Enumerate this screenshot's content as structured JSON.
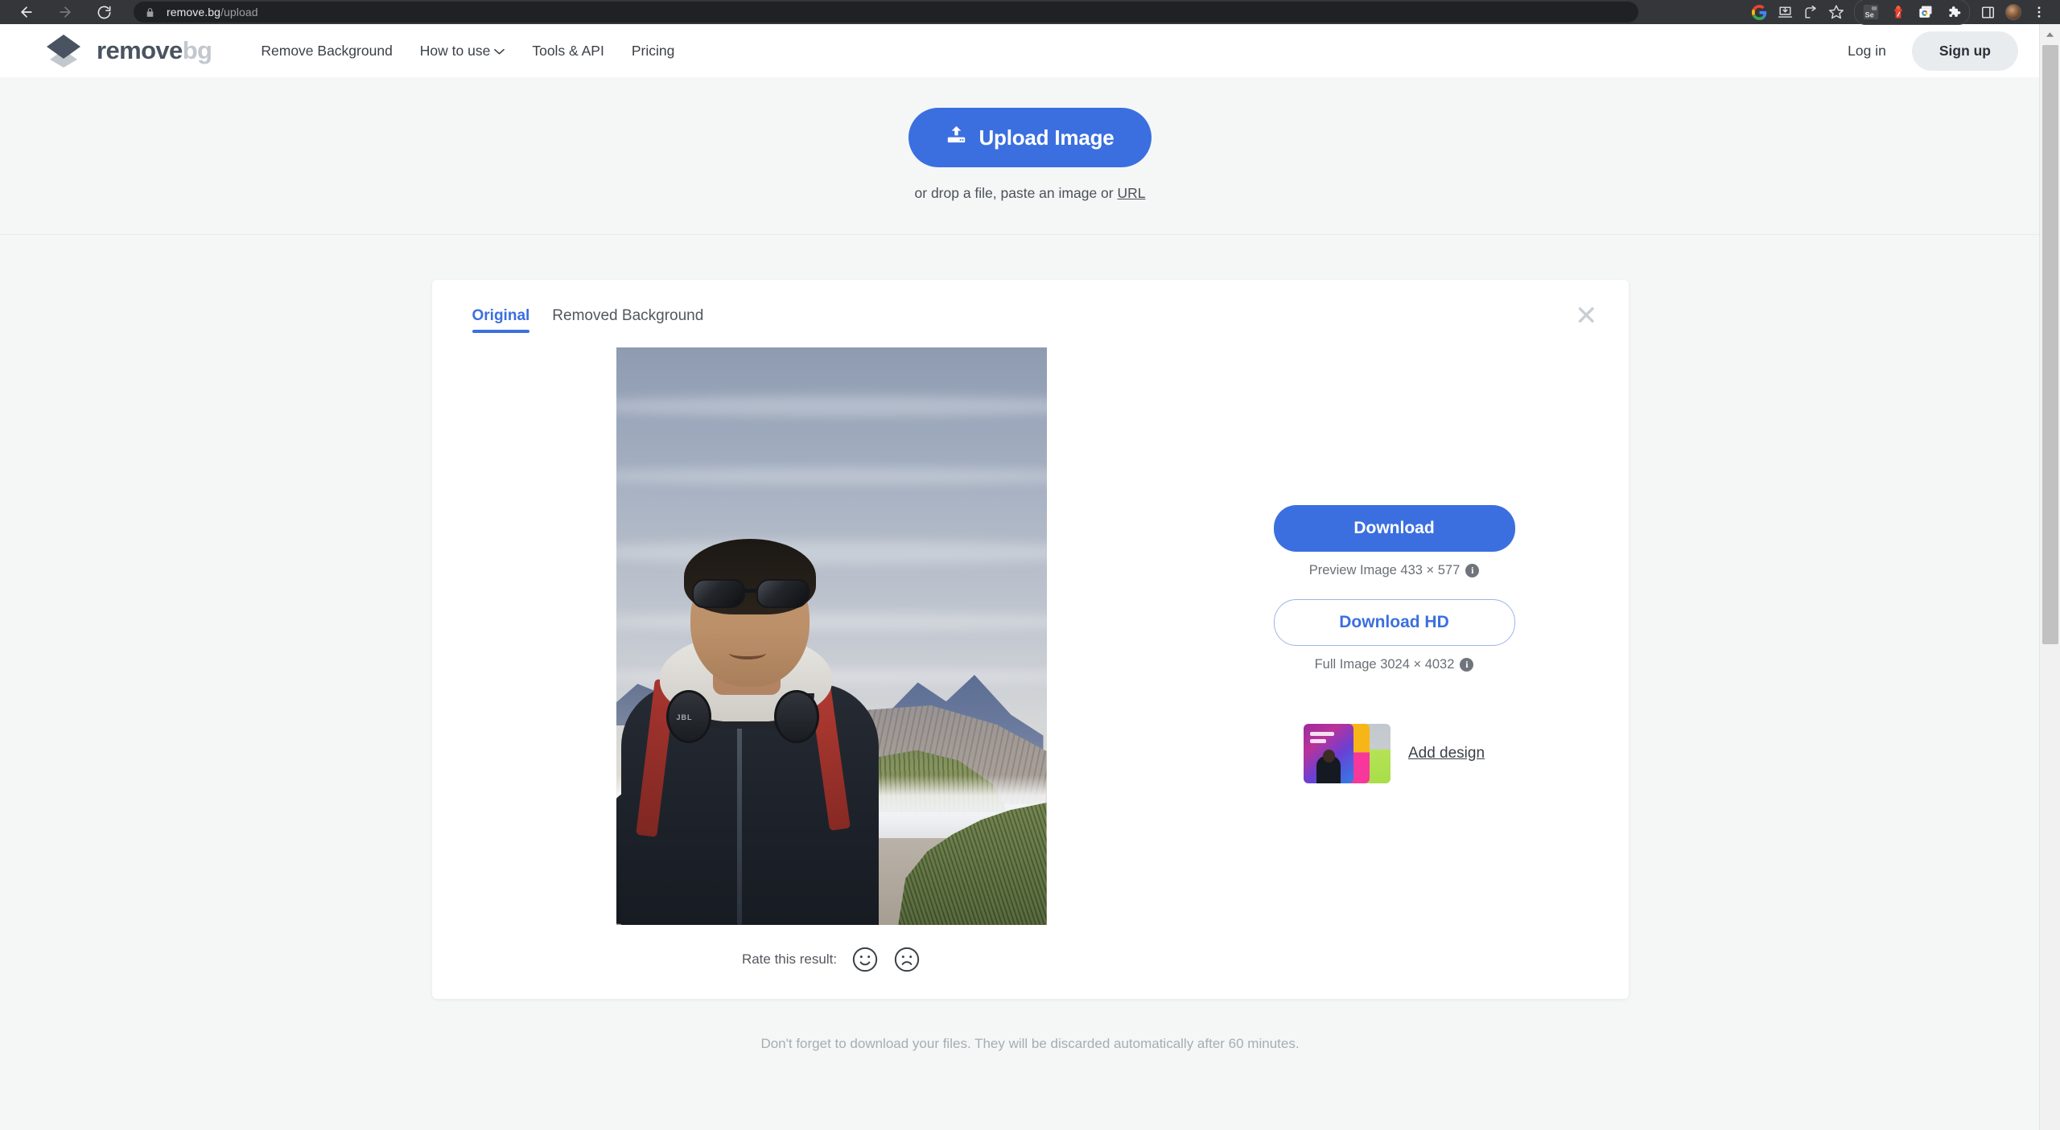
{
  "browser": {
    "back_icon": "back-arrow-icon",
    "forward_icon": "forward-arrow-icon",
    "reload_icon": "reload-icon",
    "lock_icon": "lock-icon",
    "url_host": "remove.bg",
    "url_path": "/upload",
    "toolbar_icons": [
      "google-icon",
      "downloads-icon",
      "share-icon",
      "bookmark-star-icon",
      "selenium-extension-icon",
      "postman-extension-icon",
      "chrome-photos-extension-icon",
      "extensions-puzzle-icon",
      "side-panel-icon",
      "profile-avatar",
      "chrome-menu-icon"
    ],
    "selenium_label": "Se"
  },
  "header": {
    "logo": {
      "mark": "remove-bg-diamond-logo",
      "text_primary": "remove",
      "text_secondary": "bg"
    },
    "nav": [
      {
        "label": "Remove Background",
        "has_caret": false
      },
      {
        "label": "How to use",
        "has_caret": true
      },
      {
        "label": "Tools & API",
        "has_caret": false
      },
      {
        "label": "Pricing",
        "has_caret": false
      }
    ],
    "login_label": "Log in",
    "signup_label": "Sign up"
  },
  "upload": {
    "button_label": "Upload Image",
    "upload_icon": "upload-icon",
    "drop_text_prefix": "or drop a file, paste an image or ",
    "drop_url_label": "URL"
  },
  "result": {
    "close_icon": "close-icon",
    "tabs": [
      {
        "label": "Original",
        "active": true
      },
      {
        "label": "Removed Background",
        "active": false
      }
    ],
    "photo": {
      "alt": "man-with-sunglasses-at-mount-bromo",
      "headphone_brand": "JBL"
    },
    "rate": {
      "label": "Rate this result:",
      "happy_icon": "happy-face-icon",
      "sad_icon": "sad-face-icon"
    },
    "download": {
      "primary_label": "Download",
      "preview_meta": "Preview Image 433 × 577",
      "hd_label": "Download HD",
      "full_meta": "Full Image 3024 × 4032",
      "info_glyph": "i"
    },
    "add_design": {
      "label": "Add design",
      "thumb_icon": "design-templates-thumbnail"
    }
  },
  "footer": {
    "note": "Don't forget to download your files. They will be discarded automatically after 60 minutes."
  },
  "colors": {
    "accent_blue": "#3b6fe0",
    "page_bg": "#f4f7f6",
    "logo_dark": "#4a5361",
    "logo_light": "#c3c8ce"
  },
  "scrollbar": {
    "up_arrow_icon": "scroll-up-arrow-icon"
  }
}
